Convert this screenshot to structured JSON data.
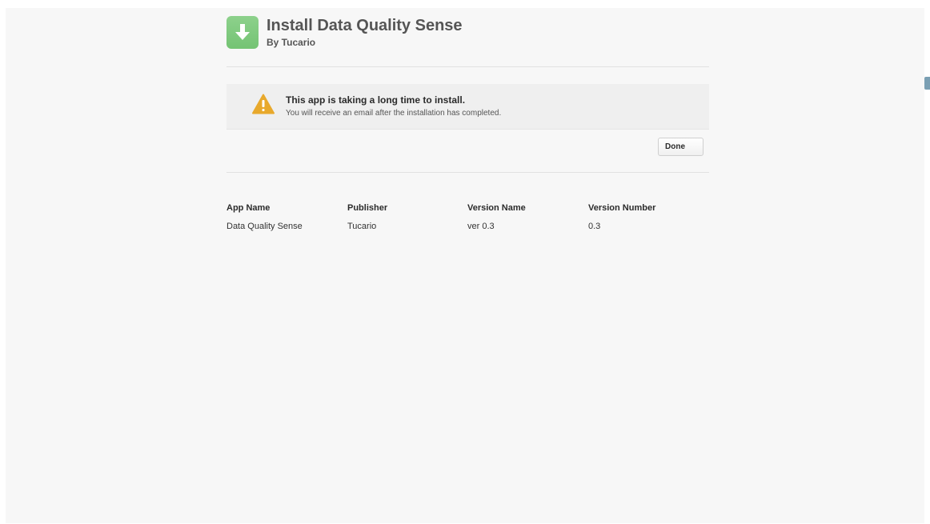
{
  "header": {
    "title": "Install Data Quality Sense",
    "subtitle": "By Tucario"
  },
  "alert": {
    "title": "This app is taking a long time to install.",
    "message": "You will receive an email after the installation has completed."
  },
  "actions": {
    "done_label": "Done"
  },
  "details": {
    "columns": [
      {
        "header": "App Name",
        "value": "Data Quality Sense"
      },
      {
        "header": "Publisher",
        "value": "Tucario"
      },
      {
        "header": "Version Name",
        "value": "ver 0.3"
      },
      {
        "header": "Version Number",
        "value": "0.3"
      }
    ]
  },
  "icons": {
    "app_icon": "download-arrow-icon",
    "alert_icon": "warning-triangle-icon"
  },
  "colors": {
    "app_icon_green": "#7ac979",
    "warning_yellow": "#e8a92c"
  }
}
